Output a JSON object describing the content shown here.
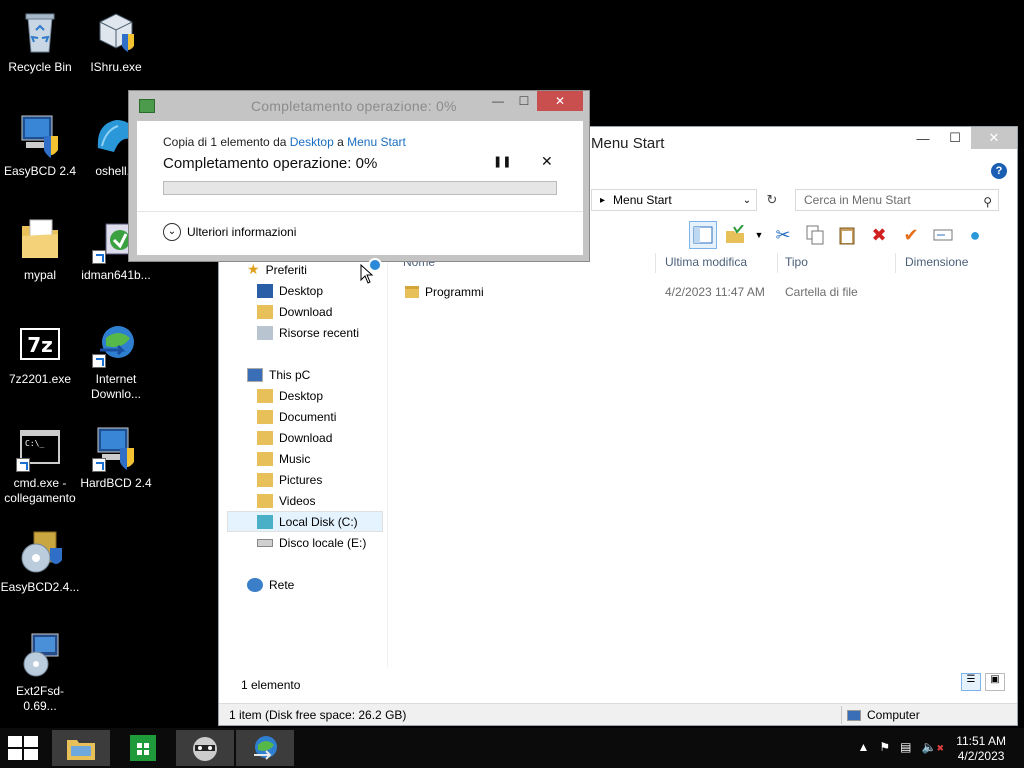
{
  "desktop": {
    "icons": [
      {
        "label": "Recycle Bin",
        "icon": "recycle-bin-icon"
      },
      {
        "label": "IShru.exe",
        "icon": "installer-shield-icon"
      },
      {
        "label": "EasyBCD 2.4",
        "icon": "easybcd-shield-icon"
      },
      {
        "label": "oshell.e",
        "icon": "shell-icon"
      },
      {
        "label": "mypal",
        "icon": "folder-icon"
      },
      {
        "label": "idman641b...",
        "icon": "installer-icon"
      },
      {
        "label": "7z2201.exe",
        "icon": "7zip-icon"
      },
      {
        "label": "Internet Downlo...",
        "icon": "idm-globe-icon"
      },
      {
        "label": "cmd.exe - collegamento",
        "icon": "cmd-icon"
      },
      {
        "label": "HardBCD 2.4",
        "icon": "hardbcd-shield-icon"
      },
      {
        "label": "EasyBCD2.4...",
        "icon": "setup-disc-icon"
      },
      {
        "label": "Ext2Fsd-0.69...",
        "icon": "ext2fsd-icon"
      }
    ]
  },
  "explorer": {
    "title": "Menu Start",
    "address": "Menu Start",
    "search_placeholder": "Cerca in Menu Start",
    "help": "?",
    "nav": {
      "favorites_header": "Preferiti",
      "favorites": [
        "Desktop",
        "Download",
        "Risorse recenti"
      ],
      "thispc_header": "This pC",
      "thispc": [
        "Desktop",
        "Documenti",
        "Download",
        "Music",
        "Pictures",
        "Videos",
        "Local Disk (C:)",
        "Disco locale (E:)"
      ],
      "network": "Rete"
    },
    "columns": {
      "name": "Nome",
      "modified": "Ultima modifica",
      "type": "Tipo",
      "size": "Dimensione"
    },
    "files": [
      {
        "name": "Programmi",
        "modified": "4/2/2023 11:47 AM",
        "type": "Cartella di file",
        "size": ""
      }
    ],
    "item_count": "1 elemento",
    "status_left": "1 item (Disk free space: 26.2 GB)",
    "status_right": "Computer"
  },
  "copy_dialog": {
    "title": "Completamento operazione: 0%",
    "line1_prefix": "Copia di 1 elemento da ",
    "source": "Desktop",
    "line1_mid": " a ",
    "destination": "Menu Start",
    "status": "Completamento operazione: 0%",
    "progress_fraction": 0,
    "more_info": "Ulteriori informazioni"
  },
  "taskbar": {
    "time": "11:51 AM",
    "date": "4/2/2023"
  },
  "colors": {
    "progress": "#06b025",
    "link": "#1a6fc2",
    "close_button": "#c94f4f"
  }
}
